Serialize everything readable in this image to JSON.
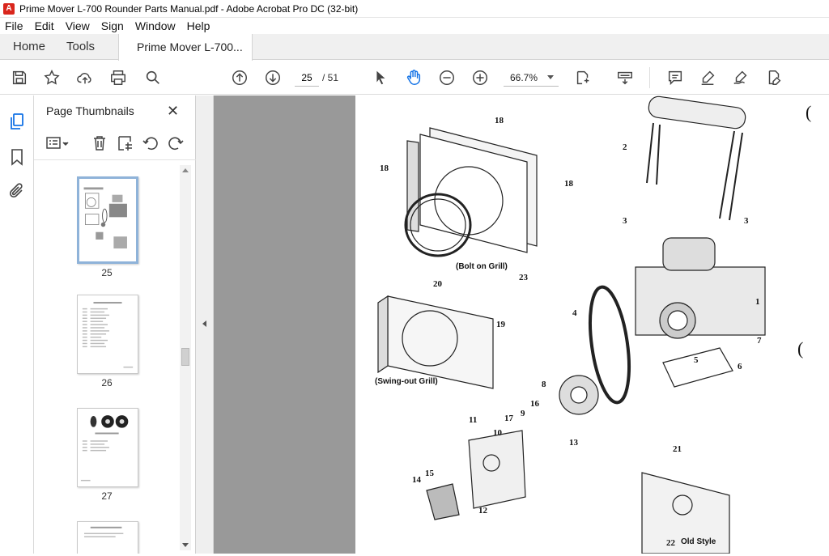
{
  "window": {
    "title": "Prime Mover L-700 Rounder Parts Manual.pdf - Adobe Acrobat Pro DC (32-bit)"
  },
  "menu": [
    "File",
    "Edit",
    "View",
    "Sign",
    "Window",
    "Help"
  ],
  "tabs": {
    "home": "Home",
    "tools": "Tools",
    "document": "Prime Mover L-700..."
  },
  "toolbar": {
    "current_page": "25",
    "total_pages": "/ 51",
    "zoom": "66.7%"
  },
  "thumbnails": {
    "title": "Page Thumbnails",
    "pages": [
      "25",
      "26",
      "27"
    ]
  },
  "diagram": {
    "callouts": [
      "18",
      "18",
      "18",
      "2",
      "3",
      "3",
      "1",
      "7",
      "5",
      "6",
      "4",
      "8",
      "16",
      "9",
      "17",
      "10",
      "11",
      "13",
      "15",
      "14",
      "12",
      "19",
      "20",
      "23",
      "21",
      "22"
    ],
    "captions": {
      "bolt_on": "(Bolt on Grill)",
      "swing_out": "(Swing-out Grill)",
      "old_style": "Old Style"
    }
  },
  "colors": {
    "doc_background": "#999999",
    "accent": "#d9261c",
    "selected_thumb": "#8fb3d9"
  }
}
